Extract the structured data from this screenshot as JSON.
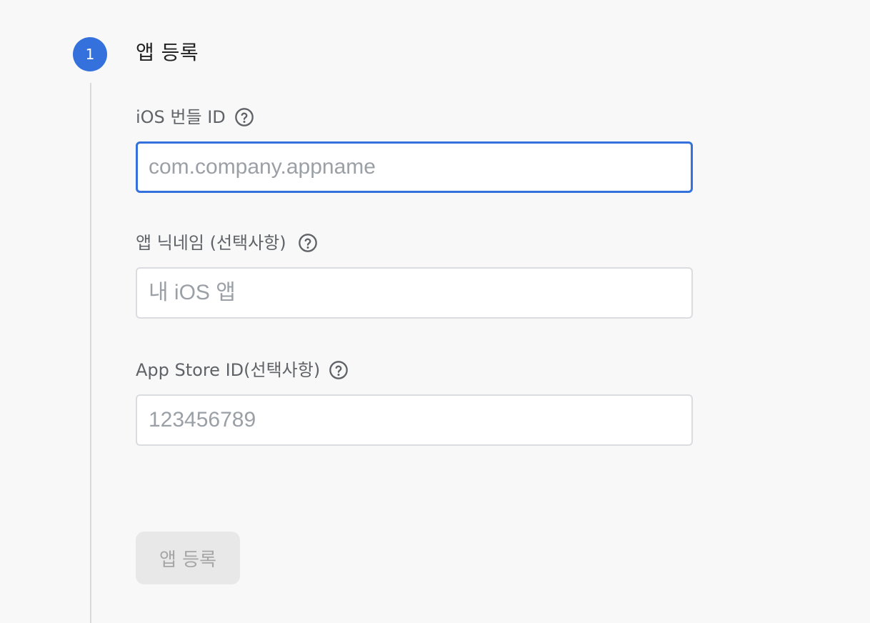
{
  "step": {
    "number": "1",
    "title": "앱 등록"
  },
  "fields": [
    {
      "label": "iOS 번들 ID",
      "value": "",
      "placeholder": "com.company.appname",
      "help_icon": "help-circle-icon"
    },
    {
      "label": "앱 닉네임 (선택사항)",
      "value": "",
      "placeholder": "내 iOS 앱",
      "help_icon": "help-circle-icon"
    },
    {
      "label": "App Store ID(선택사항)",
      "value": "",
      "placeholder": "123456789",
      "help_icon": "help-circle-icon"
    }
  ],
  "submit": {
    "label": "앱 등록",
    "disabled": true
  },
  "colors": {
    "accent": "#3571dd",
    "label": "#5f6368",
    "placeholder": "#9aa0a6",
    "border": "#dadce0",
    "disabled_bg": "#e8e8e8",
    "disabled_text": "#a6a6a6"
  }
}
